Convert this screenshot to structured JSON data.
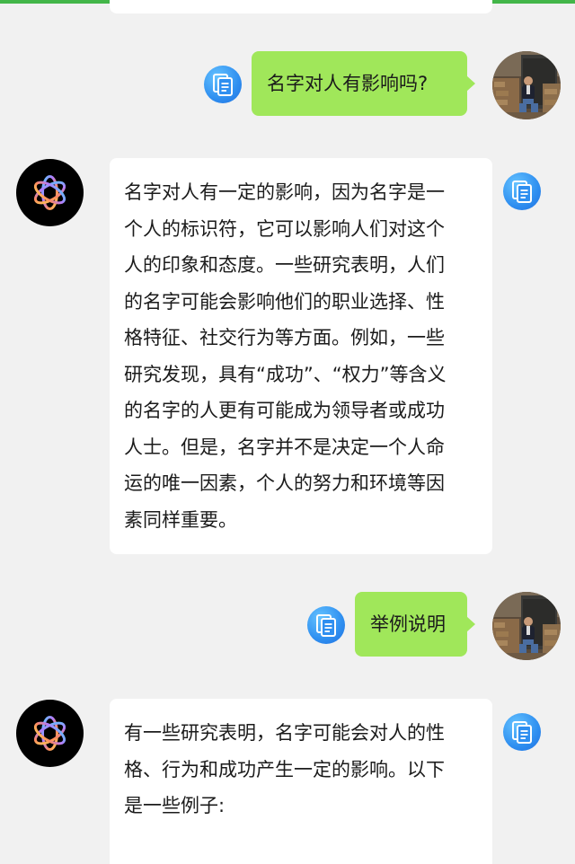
{
  "messages": [
    {
      "role": "user",
      "text": "名字对人有影响吗?"
    },
    {
      "role": "assistant",
      "text": "名字对人有一定的影响，因为名字是一\n个人的标识符，它可以影响人们对这个\n人的印象和态度。一些研究表明，人们\n的名字可能会影响他们的职业选择、性\n格特征、社交行为等方面。例如，一些\n研究发现，具有“成功”、“权力”等含义\n的名字的人更有可能成为领导者或成功\n人士。但是，名字并不是决定一个人命\n运的唯一因素，个人的努力和环境等因\n素同样重要。"
    },
    {
      "role": "user",
      "text": "举例说明"
    },
    {
      "role": "assistant",
      "text": "有一些研究表明，名字可能会对人的性\n格、行为和成功产生一定的影响。以下\n是一些例子:"
    }
  ],
  "icons": {
    "copy": "copy-icon",
    "assistant_avatar": "openai-logo-icon",
    "user_avatar": "user-photo-avatar"
  },
  "colors": {
    "top_bar": "#43b649",
    "user_bubble": "#a0e75a",
    "assistant_bubble": "#ffffff",
    "background": "#f1f1f1",
    "copy_button": "#2f8ff0"
  }
}
